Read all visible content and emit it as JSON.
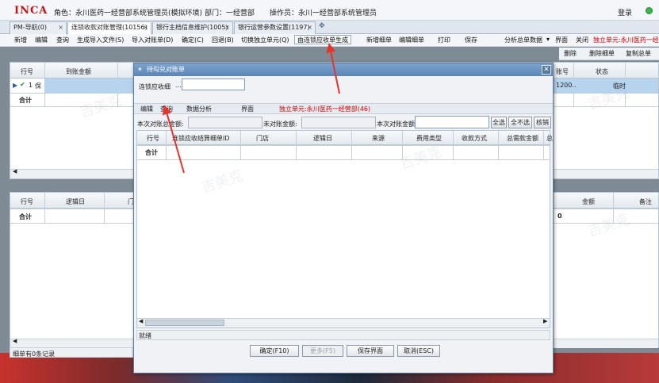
{
  "header": {
    "logo": "INCA",
    "role": "角色：永川医药一经营部系统管理员(模拟环境)",
    "dept": "部门：一经营部",
    "operator": "操作员：永川一经营部系统管理员",
    "login": "登录"
  },
  "tabs": [
    {
      "label": "PM-导航(0)",
      "close": "×"
    },
    {
      "label": "连锁收款对账管理(10156)",
      "close": "×"
    },
    {
      "label": "银行主档信息维护(1005)",
      "close": "×"
    },
    {
      "label": "银行运营参数设置(1197)",
      "close": "×"
    }
  ],
  "tab_add": "✥",
  "toolbar": {
    "items": [
      "新增",
      "编辑",
      "查询",
      "生成导入文件(S)",
      "导入对账单(D)",
      "确定(C)",
      "回退(B)",
      "切换独立单元(Q)"
    ],
    "boxed": "由连锁应收单生成",
    "items2": [
      "新增细单",
      "编辑细单",
      "打印",
      "保存"
    ],
    "summary": "分析总单数据",
    "dropdown": "▾",
    "interface": "界面",
    "close": "关闭",
    "unit": "独立单元:永川医药一经"
  },
  "toolbar2": [
    "删除",
    "删除细单",
    "复制总单"
  ],
  "grid1": {
    "col_row": "行号",
    "col_amount": "到账金额",
    "col_acct": "账号",
    "col_status": "状态",
    "row1": {
      "num": "1",
      "text": "保",
      "acct": "1200..",
      "status": "临时"
    },
    "total": "合计"
  },
  "grid2": {
    "col_row": "行号",
    "col_date": "逻辑日",
    "col_door": "门",
    "col_amount": "金额",
    "col_note": "备注",
    "total": "合计",
    "total_val": "0"
  },
  "footer_status": "细单有0条记录",
  "dialog": {
    "title": "待勾兑对账单",
    "close": "✕",
    "label_receivable": "连锁应收细",
    "search_value": "...",
    "menu": [
      "编辑",
      "查询",
      "数据分析",
      "界面"
    ],
    "unit": "独立单元:永川医药一经营部(46)",
    "label_this_total": "本次对账总金额:",
    "label_unmatched": "未对账金额:",
    "label_this_amount": "本次对账金额",
    "btn_all": "全选",
    "btn_none": "全不选",
    "btn_verify": "核销",
    "columns": [
      "行号",
      "连锁应收结算细单ID",
      "门店",
      "逻辑日",
      "来源",
      "费用类型",
      "收款方式",
      "总需款金额",
      "总"
    ],
    "total": "合计",
    "status": "就绪",
    "btn_ok": "确定(F10)",
    "btn_prev": "更多(F5)",
    "btn_save": "保存界面",
    "btn_cancel": "取消(ESC)"
  },
  "watermark": "吉美克"
}
